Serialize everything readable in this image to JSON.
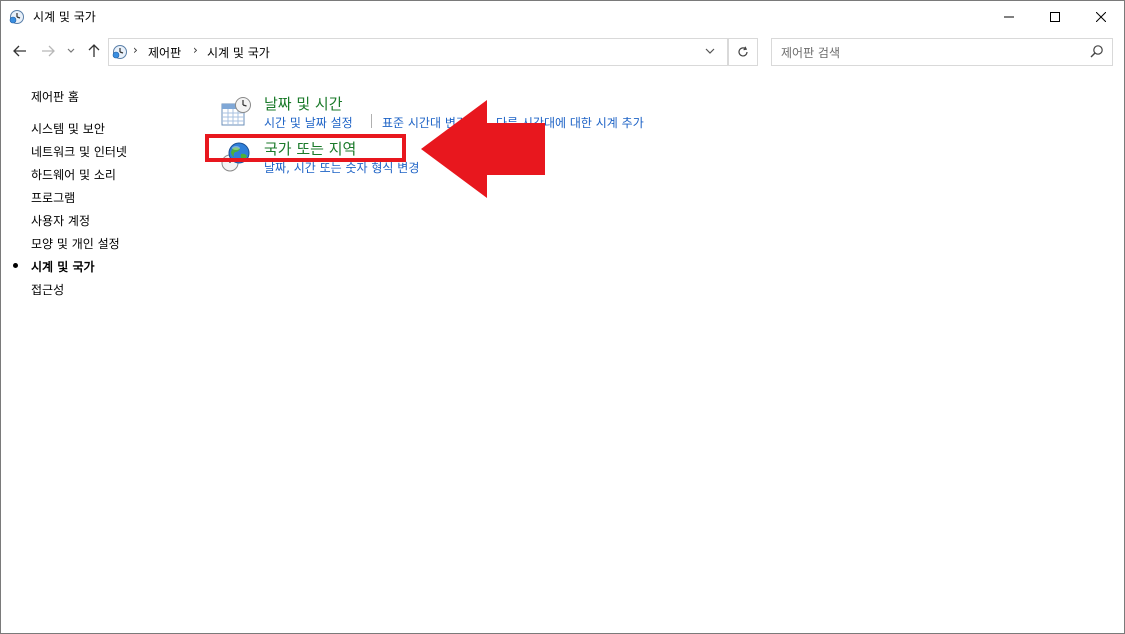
{
  "window": {
    "title": "시계 및 국가",
    "minimize_icon": "minimize-icon",
    "maximize_icon": "maximize-icon",
    "close_icon": "close-icon"
  },
  "address": {
    "crumbs": [
      "제어판",
      "시계 및 국가"
    ],
    "search_placeholder": "제어판 검색"
  },
  "sidebar": {
    "home": "제어판 홈",
    "items": [
      {
        "label": "시스템 및 보안"
      },
      {
        "label": "네트워크 및 인터넷"
      },
      {
        "label": "하드웨어 및 소리"
      },
      {
        "label": "프로그램"
      },
      {
        "label": "사용자 계정"
      },
      {
        "label": "모양 및 개인 설정"
      },
      {
        "label": "시계 및 국가"
      },
      {
        "label": "접근성"
      }
    ],
    "active_index": 6
  },
  "main": {
    "categories": [
      {
        "title": "날짜 및 시간",
        "icon": "calendar-clock-icon",
        "links": [
          "시간 및 날짜 설정",
          "표준 시간대 변경",
          "다른 시간대에 대한 시계 추가"
        ]
      },
      {
        "title": "국가 또는 지역",
        "icon": "globe-clock-icon",
        "links": [
          "날짜, 시간 또는 숫자 형식 변경"
        ]
      }
    ]
  },
  "colors": {
    "category_title": "#1a7a2a",
    "link": "#1e63c6",
    "annotation": "#e8171e"
  }
}
